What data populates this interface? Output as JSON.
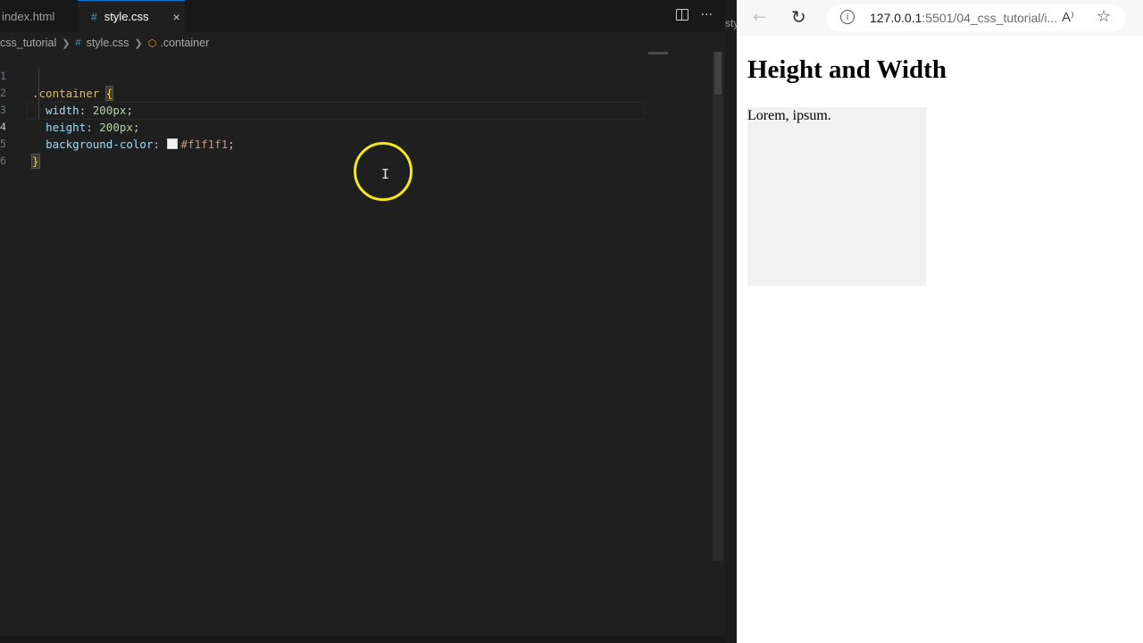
{
  "editor": {
    "tabs": [
      {
        "label": "index.html",
        "active": false
      },
      {
        "label": "style.css",
        "active": true
      }
    ],
    "tab_close_glyph": "×",
    "actions": [
      "split-editor-icon",
      "more-actions-icon"
    ],
    "more_glyph": "···",
    "breadcrumb": {
      "folder": "css_tutorial",
      "file": "style.css",
      "symbol": ".container"
    },
    "code": {
      "line_numbers": [
        "1",
        "2",
        "3",
        "4",
        "5",
        "6"
      ],
      "active_line": 4,
      "selector": ".container",
      "open_brace": "{",
      "close_brace": "}",
      "declarations": [
        {
          "property": "width",
          "value": "200px"
        },
        {
          "property": "height",
          "value": "200px"
        },
        {
          "property": "background-color",
          "value": "#f1f1f1"
        }
      ]
    },
    "peek_text": "sty"
  },
  "browser": {
    "url_host": "127.0.0.1",
    "url_rest": ":5501/04_css_tutorial/i...",
    "read_aloud_glyph": "A⁾",
    "page": {
      "heading": "Height and Width",
      "container_text": "Lorem, ipsum.",
      "container_bg": "#f1f1f1"
    }
  },
  "colors": {
    "editor_bg": "#1f1f1f",
    "selector": "#d7ba7d",
    "property": "#9cdcfe",
    "number": "#b5cea8",
    "string_hex": "#ce9178",
    "cursor_highlight": "#f2e81a",
    "accent": "#0078d4"
  }
}
